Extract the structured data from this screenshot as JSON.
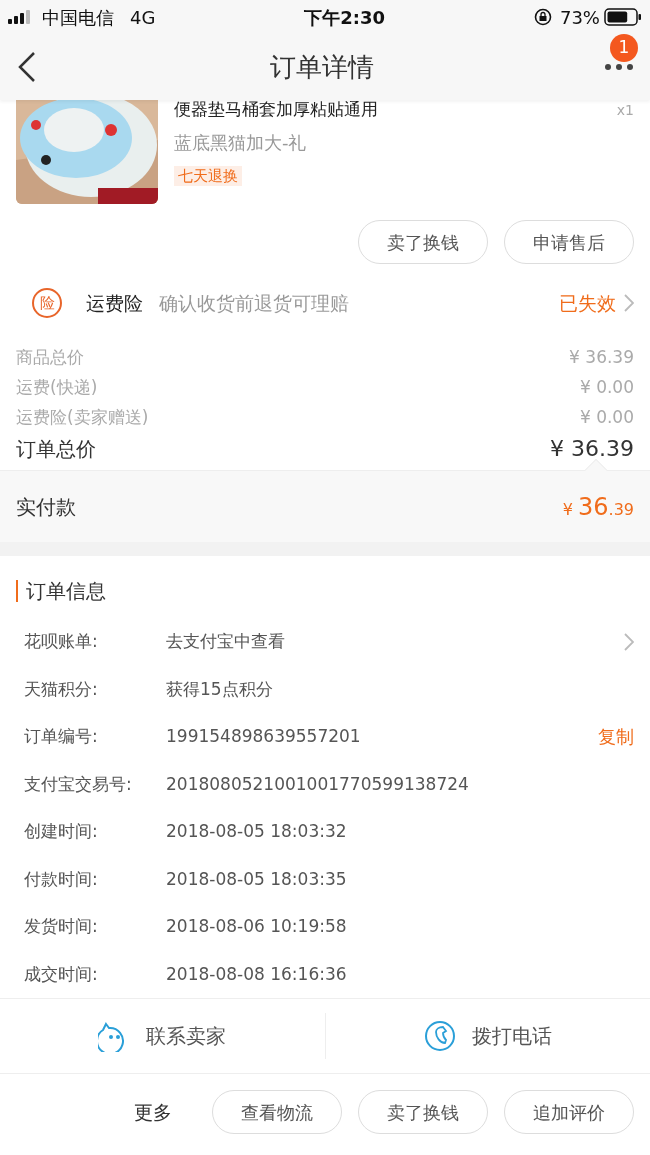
{
  "status_bar": {
    "carrier": "中国电信",
    "network": "4G",
    "time": "下午2:30",
    "battery": "73%"
  },
  "nav": {
    "title": "订单详情",
    "badge": "1"
  },
  "product": {
    "title": "便器垫马桶套加厚粘贴通用",
    "variant": "蓝底黑猫加大-礼",
    "tag": "七天退换",
    "quantity": "x1"
  },
  "product_actions": [
    "卖了换钱",
    "申请售后"
  ],
  "insurance": {
    "badge": "险",
    "name": "运费险",
    "description": "确认收货前退货可理赔",
    "status": "已失效"
  },
  "price_rows": [
    {
      "label": "商品总价",
      "value": "¥ 36.39",
      "kind": "minor"
    },
    {
      "label": "运费(快递)",
      "value": "¥ 0.00",
      "kind": "minor"
    },
    {
      "label": "运费险(卖家赠送)",
      "value": "¥ 0.00",
      "kind": "minor"
    },
    {
      "label": "订单总价",
      "value": "¥ 36.39",
      "kind": "total"
    }
  ],
  "paid": {
    "label": "实付款",
    "currency": "¥",
    "integer": "36",
    "decimal": ".39"
  },
  "order_info": {
    "title": "订单信息",
    "rows": [
      {
        "label": "花呗账单:",
        "value": "去支付宝中查看",
        "kind": "link"
      },
      {
        "label": "天猫积分:",
        "value": "获得15点积分",
        "kind": "plain"
      },
      {
        "label": "订单编号:",
        "value": "199154898639557201",
        "kind": "copy",
        "action": "复制"
      },
      {
        "label": "支付宝交易号:",
        "value": "2018080521001001770599138724",
        "kind": "plain"
      },
      {
        "label": "创建时间:",
        "value": "2018-08-05 18:03:32",
        "kind": "plain"
      },
      {
        "label": "付款时间:",
        "value": "2018-08-05 18:03:35",
        "kind": "plain"
      },
      {
        "label": "发货时间:",
        "value": "2018-08-06 10:19:58",
        "kind": "plain"
      },
      {
        "label": "成交时间:",
        "value": "2018-08-08 16:16:36",
        "kind": "plain"
      }
    ]
  },
  "contact": [
    {
      "label": "联系卖家",
      "kind": "chat"
    },
    {
      "label": "拨打电话",
      "kind": "phone"
    }
  ],
  "more": {
    "label": "更多",
    "buttons": [
      "查看物流",
      "卖了换钱",
      "追加评价"
    ]
  }
}
